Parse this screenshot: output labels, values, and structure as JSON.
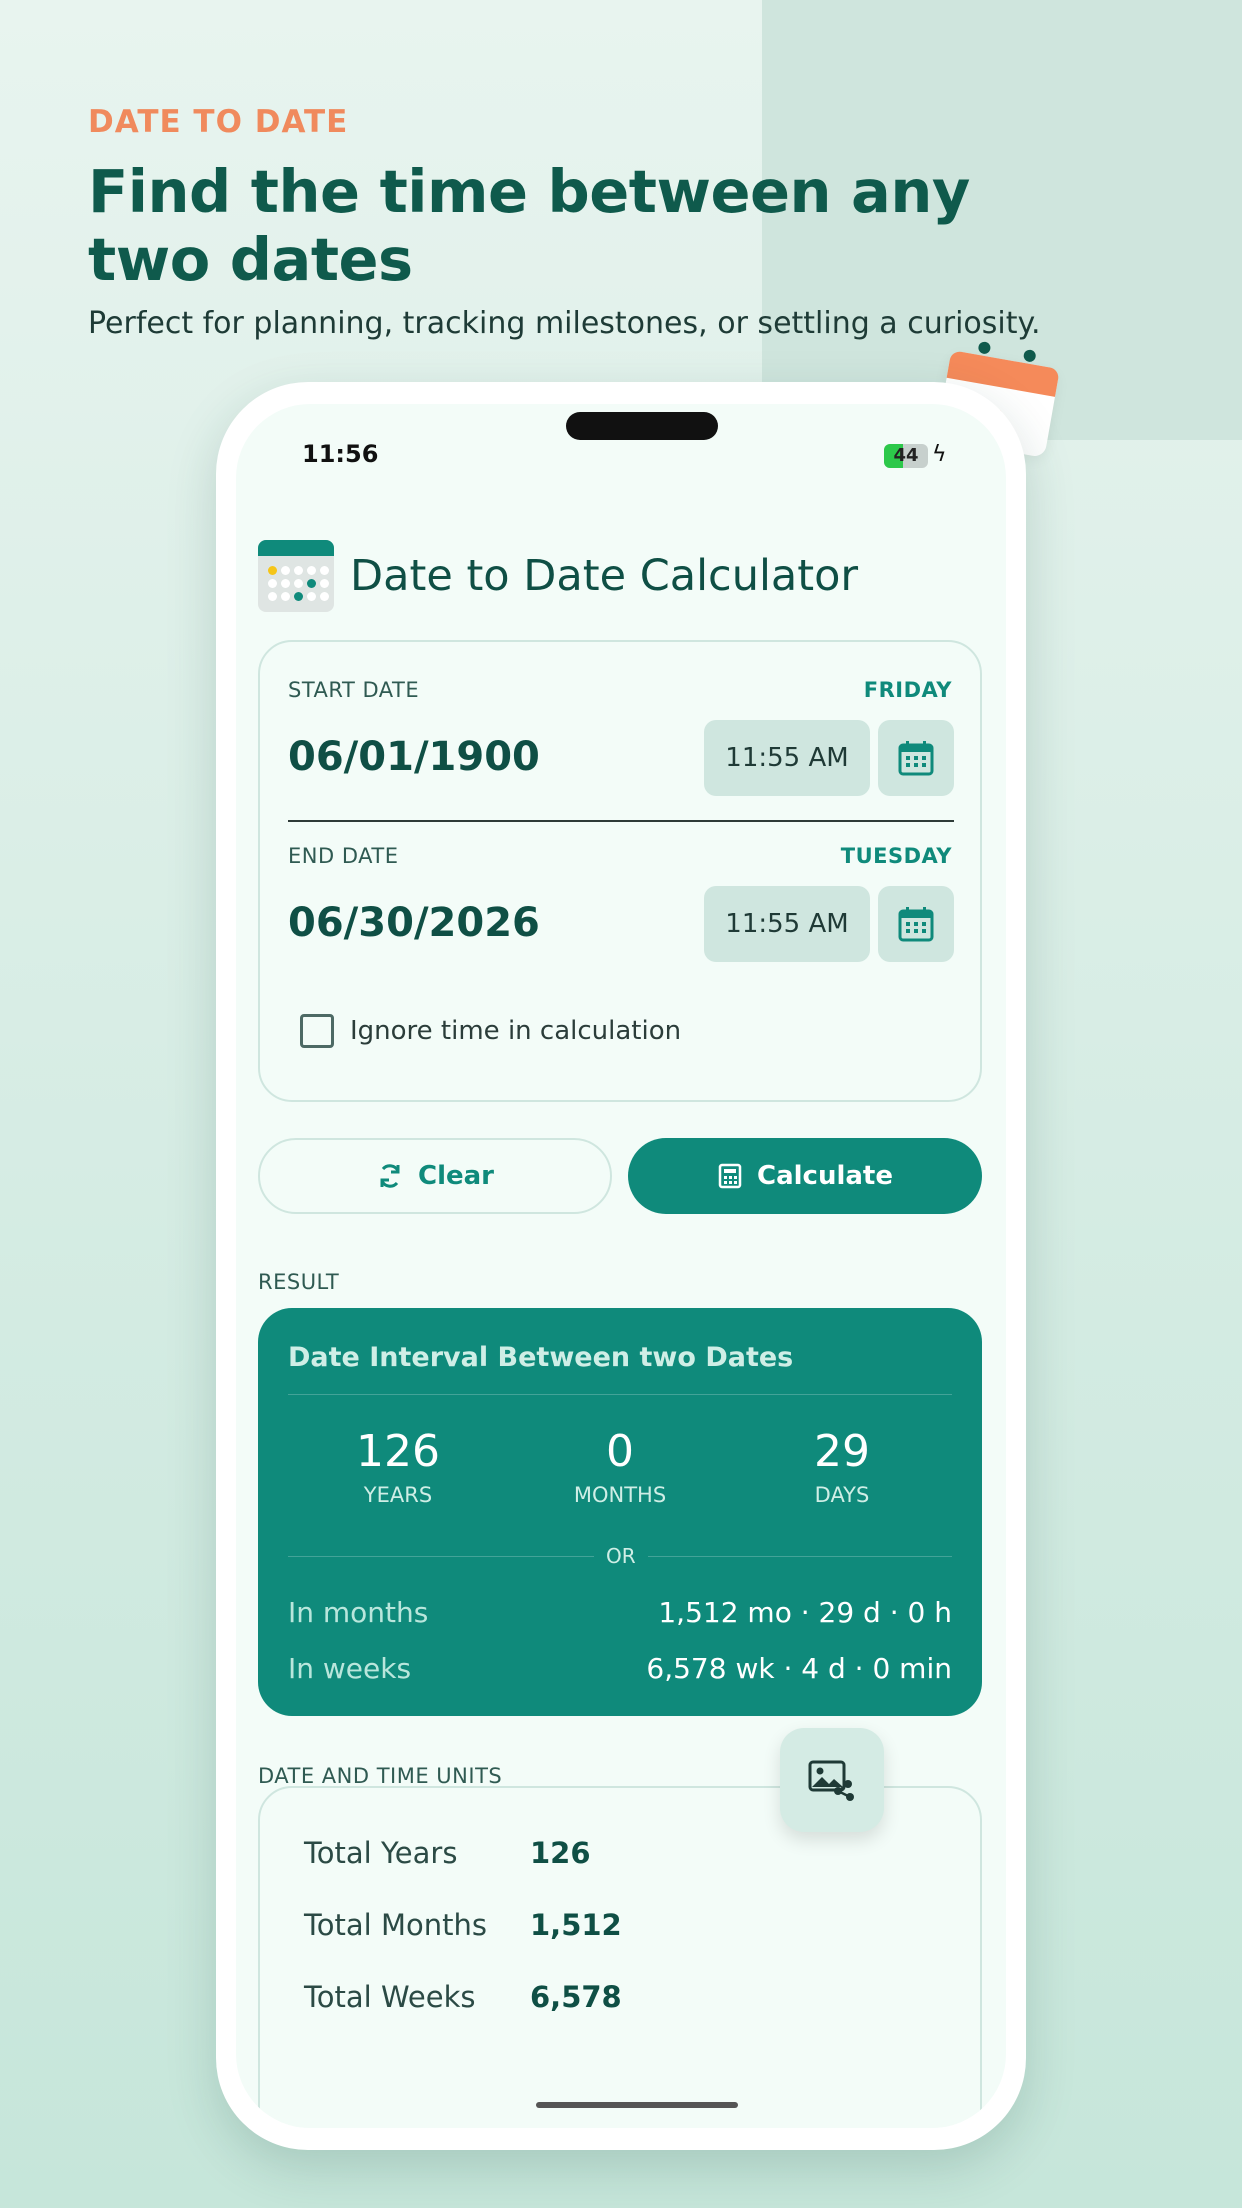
{
  "promo": {
    "eyebrow": "DATE TO DATE",
    "headline": "Find the time between any two dates",
    "subhead": "Perfect for planning, tracking milestones, or settling a curiosity."
  },
  "status_bar": {
    "time": "11:56",
    "battery": "44",
    "battery_level": 0.44
  },
  "app": {
    "title": "Date to Date Calculator",
    "icon": "calendar-app-icon"
  },
  "start": {
    "label": "START DATE",
    "weekday": "FRIDAY",
    "date": "06/01/1900",
    "time": "11:55 AM"
  },
  "end": {
    "label": "END DATE",
    "weekday": "TUESDAY",
    "date": "06/30/2026",
    "time": "11:55 AM"
  },
  "ignore_time": {
    "label": "Ignore time in calculation",
    "checked": false
  },
  "actions": {
    "clear": "Clear",
    "calculate": "Calculate"
  },
  "result": {
    "section_label": "RESULT",
    "title": "Date Interval Between two Dates",
    "years": "126",
    "years_label": "YEARS",
    "months": "0",
    "months_label": "MONTHS",
    "days": "29",
    "days_label": "DAYS",
    "or": "OR",
    "in_months_label": "In months",
    "in_months_value": "1,512 mo · 29 d · 0 h",
    "in_weeks_label": "In weeks",
    "in_weeks_value": "6,578 wk · 4 d · 0 min"
  },
  "units": {
    "section_label": "DATE AND TIME UNITS",
    "rows": [
      {
        "label": "Total Years",
        "value": "126"
      },
      {
        "label": "Total Months",
        "value": "1,512"
      },
      {
        "label": "Total Weeks",
        "value": "6,578"
      }
    ]
  },
  "colors": {
    "accent": "#0f8a7b",
    "brand_dark": "#0f5a4c",
    "orange": "#f08a5d",
    "surface": "#f3fcf8"
  }
}
